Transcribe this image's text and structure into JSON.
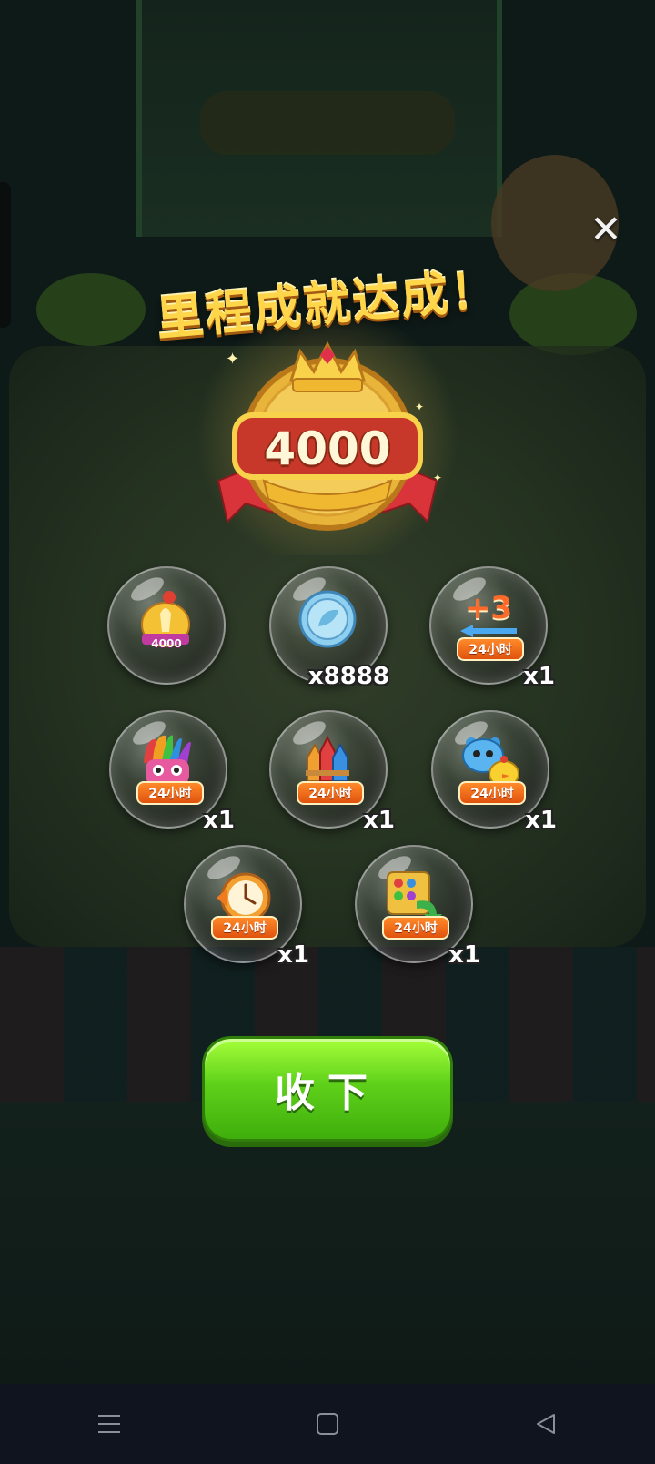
{
  "title": "里程成就达成！",
  "medal": {
    "value": "4000"
  },
  "rewards": [
    {
      "name": "chicken-trophy",
      "badge": "4000",
      "tag": "",
      "qty": ""
    },
    {
      "name": "leaf-coin",
      "tag": "",
      "qty": "x8888"
    },
    {
      "name": "plus-three-moves",
      "label": "+3",
      "tag": "24小时",
      "qty": "x1"
    },
    {
      "name": "rainbow-owl",
      "tag": "24小时",
      "qty": "x1"
    },
    {
      "name": "rockets",
      "tag": "24小时",
      "qty": "x1"
    },
    {
      "name": "blue-bear-and-chick",
      "tag": "24小时",
      "qty": "x1"
    },
    {
      "name": "clock",
      "tag": "24小时",
      "qty": "x1"
    },
    {
      "name": "shuffle-board",
      "tag": "24小时",
      "qty": "x1"
    }
  ],
  "collect_button": {
    "label": "收下"
  },
  "colors": {
    "accent_gold": "#ffd54a",
    "button_green": "#5fd11a",
    "tag_orange": "#f07020"
  },
  "nav": {
    "menu_icon": "menu-icon",
    "home_icon": "home-icon",
    "back_icon": "back-icon"
  }
}
